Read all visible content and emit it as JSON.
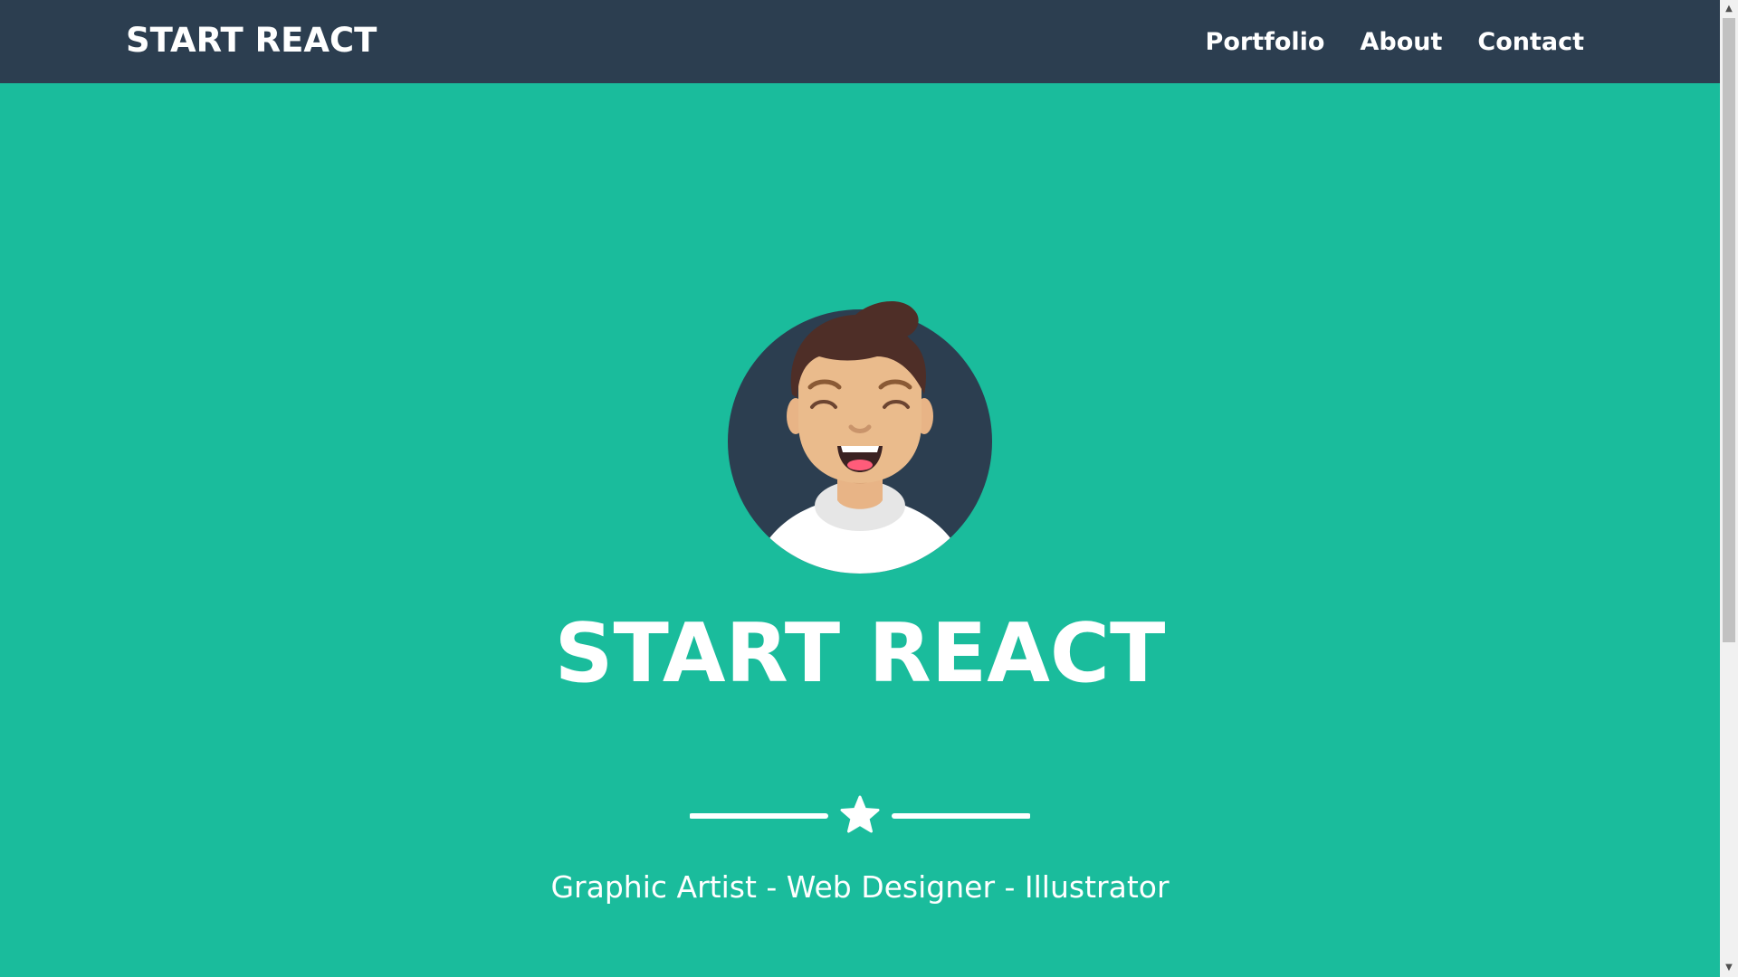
{
  "navbar": {
    "brand": "START REACT",
    "links": [
      "Portfolio",
      "About",
      "Contact"
    ]
  },
  "hero": {
    "avatar_icon": "smiling-man-avatar",
    "title": "START REACT",
    "divider_icon": "star-icon",
    "subtitle": "Graphic Artist - Web Designer - Illustrator"
  },
  "colors": {
    "navbar_bg": "#2c3e50",
    "hero_bg": "#1abc9c",
    "text": "#ffffff"
  },
  "scrollbar": {
    "up_icon": "scroll-up-arrow-icon",
    "down_icon": "scroll-down-arrow-icon"
  }
}
